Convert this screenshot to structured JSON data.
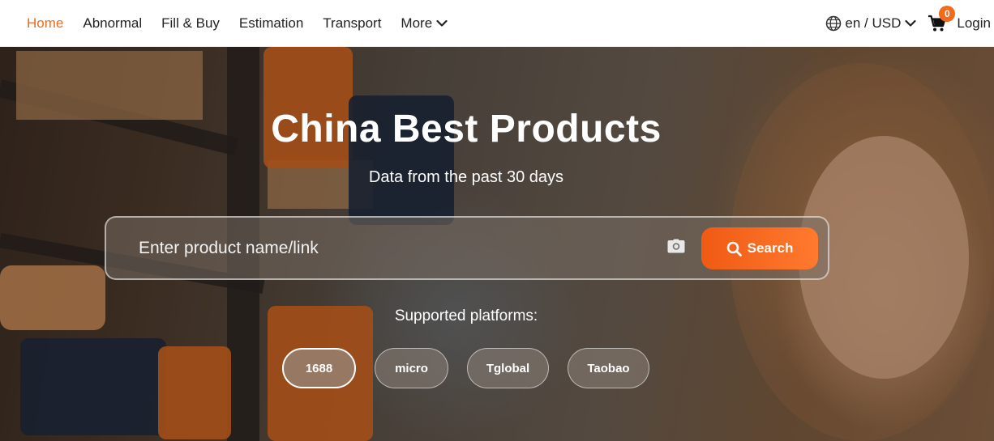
{
  "nav": {
    "items": [
      {
        "label": "Home",
        "active": true
      },
      {
        "label": "Abnormal",
        "active": false
      },
      {
        "label": "Fill & Buy",
        "active": false
      },
      {
        "label": "Estimation",
        "active": false
      },
      {
        "label": "Transport",
        "active": false
      },
      {
        "label": "More",
        "active": false
      }
    ],
    "language": "en / USD",
    "cart_count": "0",
    "login": "Login",
    "accent_color": "#f26a1b"
  },
  "hero": {
    "title": "China Best Products",
    "subtitle": "Data from the past 30 days",
    "search": {
      "placeholder": "Enter product name/link",
      "value": "",
      "button_label": "Search"
    },
    "platforms_label": "Supported platforms:",
    "platforms": [
      {
        "label": "1688",
        "selected": true
      },
      {
        "label": "micro",
        "selected": false
      },
      {
        "label": "Tglobal",
        "selected": false
      },
      {
        "label": "Taobao",
        "selected": false
      }
    ]
  },
  "icons": {
    "more": "chevron-down-icon",
    "language": "globe-icon",
    "cart": "cart-icon",
    "camera": "camera-icon",
    "search": "search-icon"
  }
}
